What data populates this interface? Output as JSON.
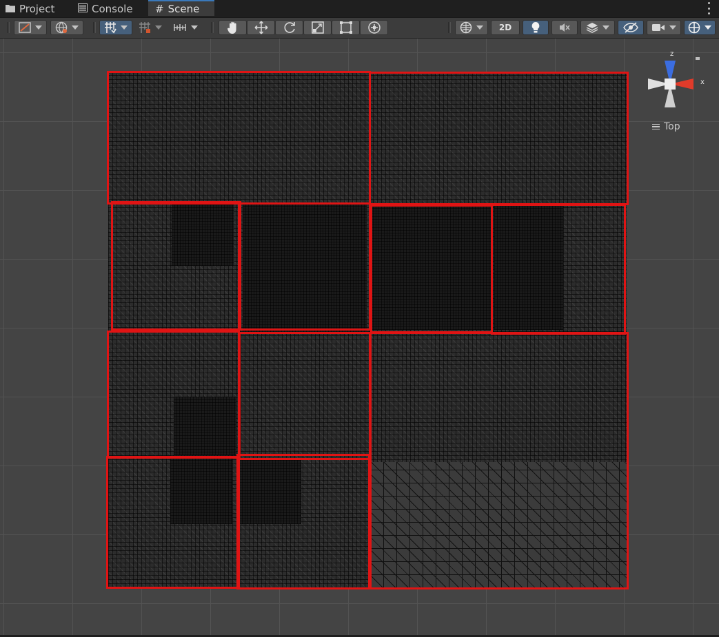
{
  "tabs": [
    {
      "label": "Project",
      "icon": "folder-icon",
      "active": false
    },
    {
      "label": "Console",
      "icon": "console-icon",
      "active": false
    },
    {
      "label": "Scene",
      "icon": "#",
      "active": true
    }
  ],
  "toolbar": {
    "toggle_2d_label": "2D"
  },
  "gizmo": {
    "axis_y": "z",
    "axis_x": "x",
    "view_label": "Top"
  },
  "colors": {
    "tile_outline": "#e01414",
    "gizmo_z": "#3b6de0",
    "gizmo_x": "#e03b2a",
    "active_tab_accent": "#3a79bb"
  }
}
